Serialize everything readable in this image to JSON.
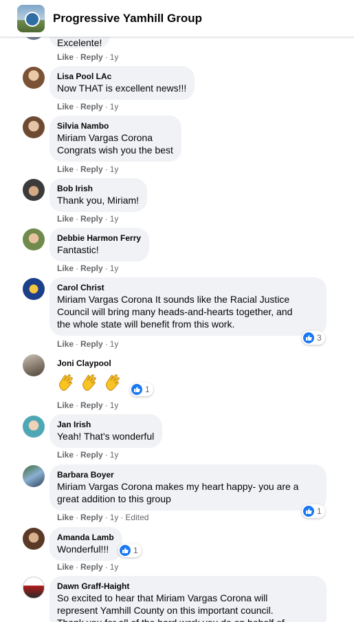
{
  "header": {
    "group_name": "Progressive Yamhill Group"
  },
  "labels": {
    "like": "Like",
    "reply": "Reply",
    "separator": "·"
  },
  "comments": [
    {
      "author": "",
      "text": "Excelente!",
      "time": "1y"
    },
    {
      "author": "Lisa Pool LAc",
      "text": "Now THAT is excellent news!!!",
      "time": "1y"
    },
    {
      "author": "Silvia Nambo",
      "text": "Miriam Vargas Corona\nCongrats wish you the best",
      "time": "1y"
    },
    {
      "author": "Bob Irish",
      "text": "Thank you, Miriam!",
      "time": "1y"
    },
    {
      "author": "Debbie Harmon Ferry",
      "text": "Fantastic!",
      "time": "1y"
    },
    {
      "author": "Carol Christ",
      "text": "Miriam Vargas Corona It sounds like the Racial Justice\nCouncil will bring many heads-and-hearts together, and\nthe whole state will benefit from this work.",
      "time": "1y",
      "reaction_count": "3"
    },
    {
      "author": "Joni Claypool",
      "text": "",
      "emoji": "clapping-hands x3",
      "time": "1y",
      "reaction_count": "1"
    },
    {
      "author": "Jan Irish",
      "text": "Yeah! That's wonderful",
      "time": "1y"
    },
    {
      "author": "Barbara Boyer",
      "text": "Miriam Vargas Corona makes my heart happy- you are a\ngreat addition to this group",
      "time": "1y",
      "edited": "Edited",
      "reaction_count": "1"
    },
    {
      "author": "Amanda Lamb",
      "text": "Wonderful!!!",
      "time": "1y",
      "reaction_count": "1"
    },
    {
      "author": "Dawn Graff-Haight",
      "text": "So excited to hear that Miriam Vargas Corona will\nrepresent Yamhill County on this important council.\nThank you for all of the hard work you do on behalf of",
      "time": ""
    }
  ],
  "colors": {
    "bubble": "#f0f2f5",
    "meta_text": "#65676b",
    "like_blue": "#1877f2",
    "text": "#050505"
  }
}
